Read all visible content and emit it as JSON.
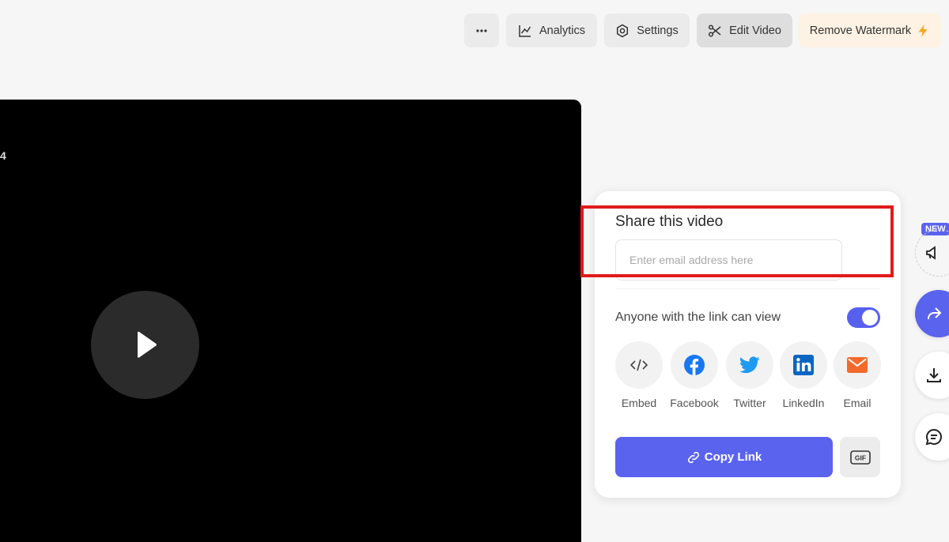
{
  "toolbar": {
    "more_icon": "more-dots-icon",
    "analytics_label": "Analytics",
    "analytics_icon": "chart-line-icon",
    "settings_label": "Settings",
    "settings_icon": "gear-icon",
    "edit_label": "Edit Video",
    "edit_icon": "scissors-icon",
    "watermark_label": "Remove Watermark",
    "watermark_icon": "lightning-icon",
    "watermark_icon_color": "#f5a623"
  },
  "video": {
    "label": "4",
    "play_icon": "play-icon"
  },
  "share": {
    "title": "Share this video",
    "email_placeholder": "Enter email address here",
    "link_access_label": "Anyone with the link can view",
    "link_access_enabled": true,
    "options": [
      {
        "label": "Embed",
        "icon": "code-icon"
      },
      {
        "label": "Facebook",
        "icon": "facebook-icon",
        "color": "#1877f2"
      },
      {
        "label": "Twitter",
        "icon": "twitter-icon",
        "color": "#1d9bf0"
      },
      {
        "label": "LinkedIn",
        "icon": "linkedin-icon",
        "color": "#0a66c2"
      },
      {
        "label": "Email",
        "icon": "envelope-icon",
        "color": "#f26b2c"
      }
    ],
    "copy_link_label": "Copy Link",
    "gif_label": "GIF",
    "accent_color": "#5a63ee"
  },
  "sidebar": {
    "new_badge": "NEW",
    "items": [
      "megaphone-icon",
      "share-arrow-icon",
      "download-icon",
      "comment-icon"
    ]
  },
  "highlight_color": "#e11b1b"
}
